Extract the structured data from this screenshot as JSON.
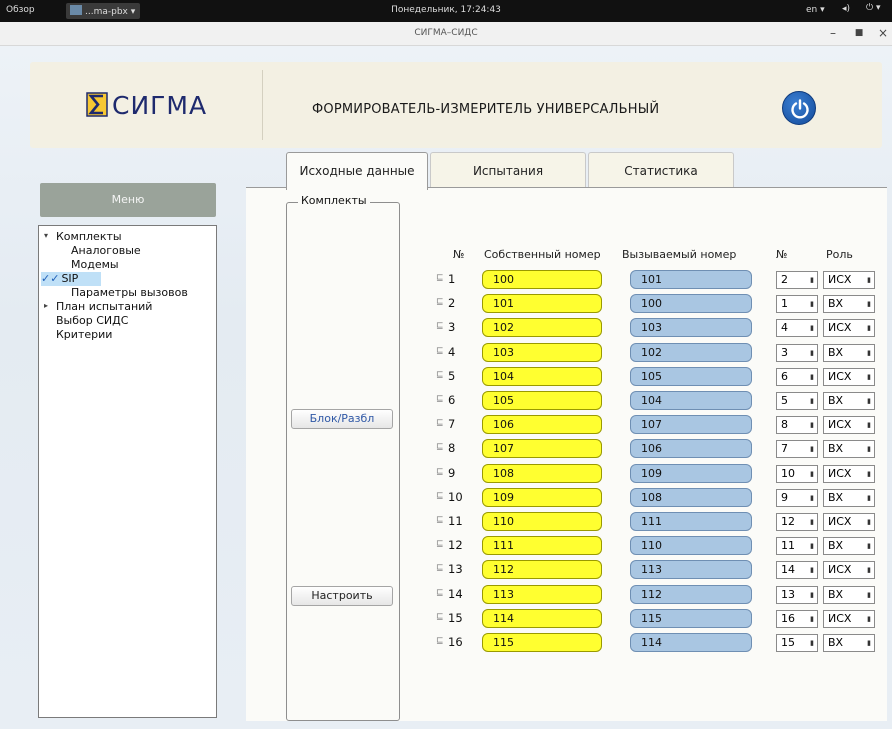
{
  "topbar": {
    "activities": "Обзор",
    "app_name": "...ma-pbx ▾",
    "clock": "Понедельник, 17:24:43",
    "lang": "en ▾",
    "volume_icon": "◂)",
    "power_icon": "⏻ ▾"
  },
  "window": {
    "title": "СИГМА–СИДС",
    "min": "–",
    "max": "■",
    "close": "×"
  },
  "header": {
    "logo_text": "СИГМА",
    "product_name": "ФОРМИРОВАТЕЛЬ-ИЗМЕРИТЕЛЬ УНИВЕРСАЛЬНЫЙ",
    "accent": "#1e2a6e",
    "power_color": "#1f5fb8"
  },
  "tabs": [
    "Исходные данные",
    "Испытания",
    "Статистика"
  ],
  "menu": {
    "title": "Меню",
    "items": [
      {
        "label": "Комплекты",
        "level": 0,
        "arrow": "▾"
      },
      {
        "label": "Аналоговые",
        "level": 1
      },
      {
        "label": "Модемы",
        "level": 1
      },
      {
        "label": "SIP",
        "level": 1,
        "selected": true,
        "check": "✓✓"
      },
      {
        "label": "Параметры вызовов",
        "level": 1
      },
      {
        "label": "План испытаний",
        "level": 0,
        "arrow": "▸"
      },
      {
        "label": "Выбор СИДС",
        "level": 0
      },
      {
        "label": "Критерии",
        "level": 0
      }
    ]
  },
  "group": {
    "title": "Комплекты",
    "block_button": "Блок/Разбл",
    "setup_button": "Настроить"
  },
  "table": {
    "headers": {
      "num": "№",
      "own": "Собственный номер",
      "called": "Вызываемый номер",
      "pair": "№",
      "role": "Роль"
    },
    "rows": [
      {
        "n": "1",
        "own": "100",
        "called": "101",
        "pair": "2",
        "role": "ИСХ"
      },
      {
        "n": "2",
        "own": "101",
        "called": "100",
        "pair": "1",
        "role": "ВХ"
      },
      {
        "n": "3",
        "own": "102",
        "called": "103",
        "pair": "4",
        "role": "ИСХ"
      },
      {
        "n": "4",
        "own": "103",
        "called": "102",
        "pair": "3",
        "role": "ВХ"
      },
      {
        "n": "5",
        "own": "104",
        "called": "105",
        "pair": "6",
        "role": "ИСХ"
      },
      {
        "n": "6",
        "own": "105",
        "called": "104",
        "pair": "5",
        "role": "ВХ"
      },
      {
        "n": "7",
        "own": "106",
        "called": "107",
        "pair": "8",
        "role": "ИСХ"
      },
      {
        "n": "8",
        "own": "107",
        "called": "106",
        "pair": "7",
        "role": "ВХ"
      },
      {
        "n": "9",
        "own": "108",
        "called": "109",
        "pair": "10",
        "role": "ИСХ"
      },
      {
        "n": "10",
        "own": "109",
        "called": "108",
        "pair": "9",
        "role": "ВХ"
      },
      {
        "n": "11",
        "own": "110",
        "called": "111",
        "pair": "12",
        "role": "ИСХ"
      },
      {
        "n": "12",
        "own": "111",
        "called": "110",
        "pair": "11",
        "role": "ВХ"
      },
      {
        "n": "13",
        "own": "112",
        "called": "113",
        "pair": "14",
        "role": "ИСХ"
      },
      {
        "n": "14",
        "own": "113",
        "called": "112",
        "pair": "13",
        "role": "ВХ"
      },
      {
        "n": "15",
        "own": "114",
        "called": "115",
        "pair": "16",
        "role": "ИСХ"
      },
      {
        "n": "16",
        "own": "115",
        "called": "114",
        "pair": "15",
        "role": "ВХ"
      }
    ]
  },
  "icons": {
    "row_icon": "⊑",
    "spin_arrow": "▮",
    "role_arrow": "▮"
  },
  "colors": {
    "own_field": "#ffff30",
    "called_field": "#a9c6e2",
    "menu_header": "#9aa39a",
    "selection": "#bfe0f7"
  }
}
